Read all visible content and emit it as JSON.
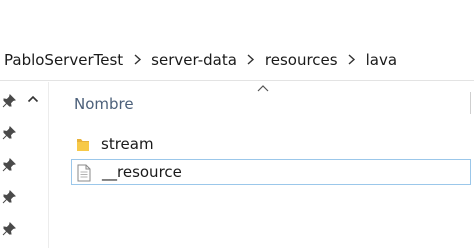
{
  "breadcrumb": {
    "items": [
      "PabloServerTest",
      "server-data",
      "resources",
      "lava"
    ]
  },
  "file_list": {
    "column_header": "Nombre",
    "rows": [
      {
        "name": "stream",
        "icon": "folder-icon"
      },
      {
        "name": "__resource",
        "icon": "file-icon"
      }
    ]
  },
  "colors": {
    "folder": "#f7c948",
    "selection_border": "#9bc7ea",
    "header_text": "#4c607a"
  }
}
